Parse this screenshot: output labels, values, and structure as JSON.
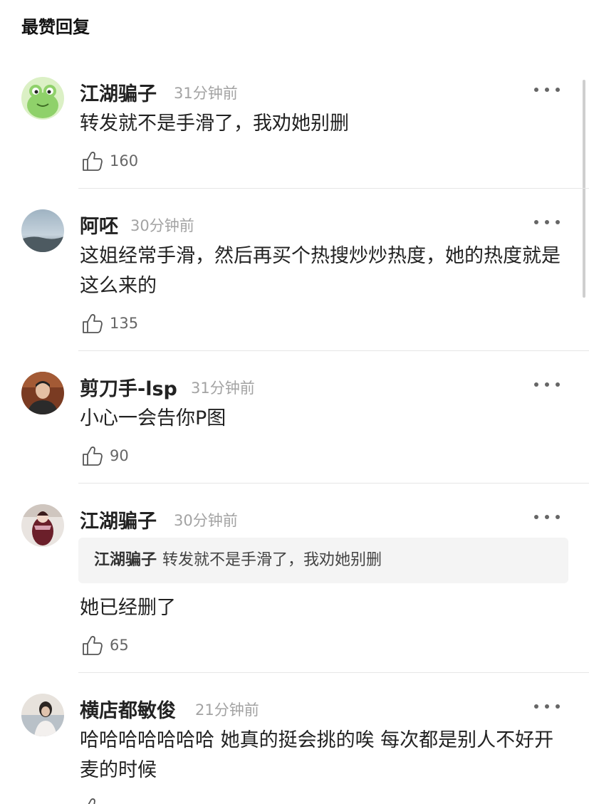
{
  "section": {
    "title": "最赞回复"
  },
  "comments": [
    {
      "name": "江湖骗子",
      "time": "31分钟前",
      "text": "转发就不是手滑了，我劝她别删",
      "likes": "160",
      "avatar": "frog-avatar"
    },
    {
      "name": "阿呸",
      "time": "30分钟前",
      "text": "这姐经常手滑，然后再买个热搜炒炒热度，她的热度就是这么来的",
      "likes": "135",
      "avatar": "sky-avatar"
    },
    {
      "name": "剪刀手-lsp",
      "time": "31分钟前",
      "text": "小心一会告你P图",
      "likes": "90",
      "avatar": "person-avatar"
    },
    {
      "name": "江湖骗子",
      "time": "30分钟前",
      "quote": {
        "name": "江湖骗子",
        "text": "转发就不是手滑了，我劝她别删"
      },
      "text": "她已经删了",
      "likes": "65",
      "avatar": "figure-avatar"
    },
    {
      "name": "横店都敏俊",
      "time": "21分钟前",
      "text": "哈哈哈哈哈哈哈 她真的挺会挑的唉 每次都是别人不好开麦的时候",
      "likes": "",
      "avatar": "photo-avatar"
    }
  ],
  "colors": {
    "name": "#222222",
    "time": "#a3a3a3",
    "divider": "#e6e6e6",
    "quote_bg": "#f4f4f4"
  }
}
